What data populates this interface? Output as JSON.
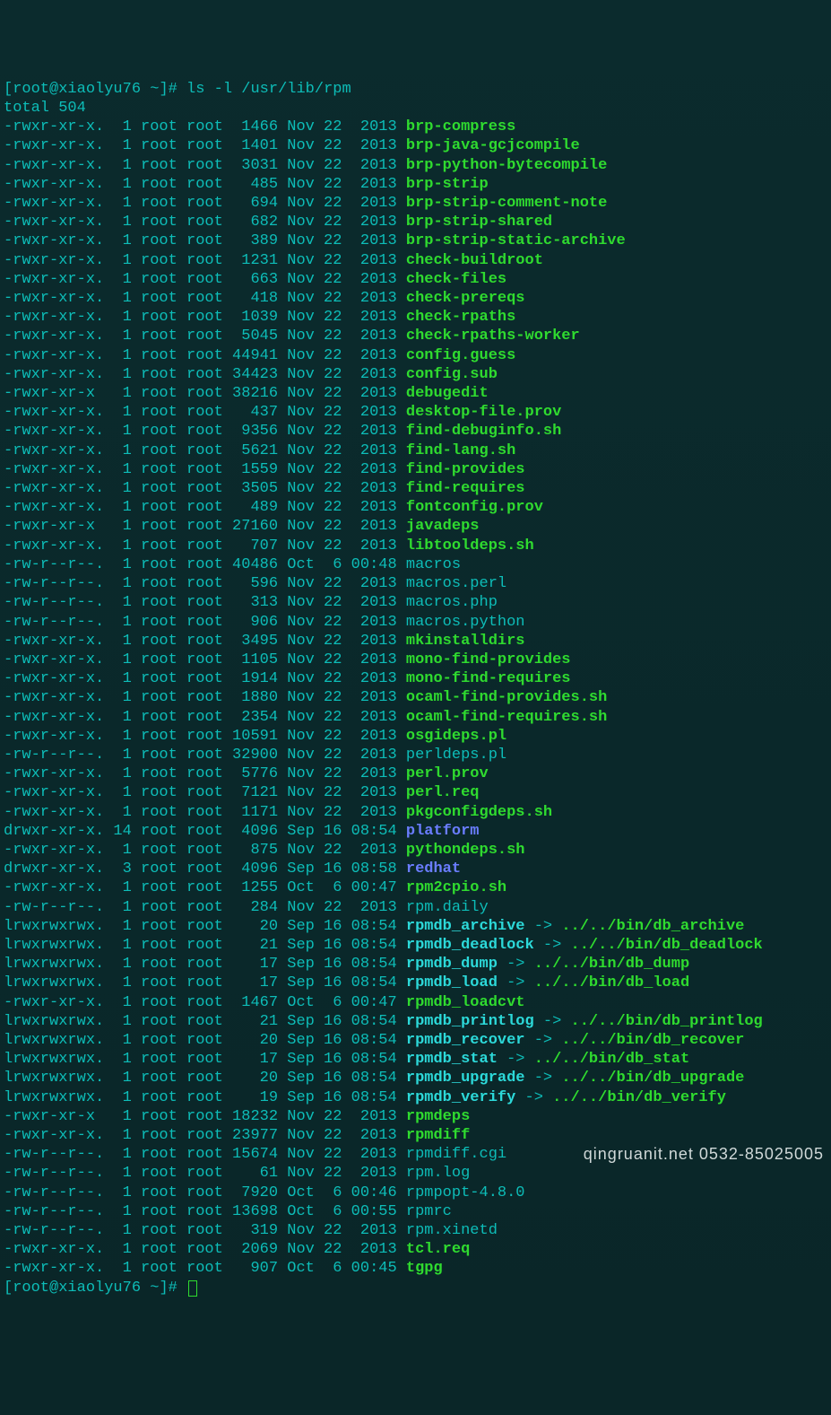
{
  "prompt": {
    "user_host": "root@xiaolyu76",
    "cwd": "~",
    "symbol": "#",
    "command": "ls -l /usr/lib/rpm"
  },
  "total_line": "total 504",
  "entries": [
    {
      "perm": "-rwxr-xr-x.",
      "links": "1",
      "owner": "root",
      "group": "root",
      "size": "1466",
      "month": "Nov",
      "day": "22",
      "time": "2013",
      "name": "brp-compress",
      "type": "exec"
    },
    {
      "perm": "-rwxr-xr-x.",
      "links": "1",
      "owner": "root",
      "group": "root",
      "size": "1401",
      "month": "Nov",
      "day": "22",
      "time": "2013",
      "name": "brp-java-gcjcompile",
      "type": "exec"
    },
    {
      "perm": "-rwxr-xr-x.",
      "links": "1",
      "owner": "root",
      "group": "root",
      "size": "3031",
      "month": "Nov",
      "day": "22",
      "time": "2013",
      "name": "brp-python-bytecompile",
      "type": "exec"
    },
    {
      "perm": "-rwxr-xr-x.",
      "links": "1",
      "owner": "root",
      "group": "root",
      "size": "485",
      "month": "Nov",
      "day": "22",
      "time": "2013",
      "name": "brp-strip",
      "type": "exec"
    },
    {
      "perm": "-rwxr-xr-x.",
      "links": "1",
      "owner": "root",
      "group": "root",
      "size": "694",
      "month": "Nov",
      "day": "22",
      "time": "2013",
      "name": "brp-strip-comment-note",
      "type": "exec"
    },
    {
      "perm": "-rwxr-xr-x.",
      "links": "1",
      "owner": "root",
      "group": "root",
      "size": "682",
      "month": "Nov",
      "day": "22",
      "time": "2013",
      "name": "brp-strip-shared",
      "type": "exec"
    },
    {
      "perm": "-rwxr-xr-x.",
      "links": "1",
      "owner": "root",
      "group": "root",
      "size": "389",
      "month": "Nov",
      "day": "22",
      "time": "2013",
      "name": "brp-strip-static-archive",
      "type": "exec"
    },
    {
      "perm": "-rwxr-xr-x.",
      "links": "1",
      "owner": "root",
      "group": "root",
      "size": "1231",
      "month": "Nov",
      "day": "22",
      "time": "2013",
      "name": "check-buildroot",
      "type": "exec"
    },
    {
      "perm": "-rwxr-xr-x.",
      "links": "1",
      "owner": "root",
      "group": "root",
      "size": "663",
      "month": "Nov",
      "day": "22",
      "time": "2013",
      "name": "check-files",
      "type": "exec"
    },
    {
      "perm": "-rwxr-xr-x.",
      "links": "1",
      "owner": "root",
      "group": "root",
      "size": "418",
      "month": "Nov",
      "day": "22",
      "time": "2013",
      "name": "check-prereqs",
      "type": "exec"
    },
    {
      "perm": "-rwxr-xr-x.",
      "links": "1",
      "owner": "root",
      "group": "root",
      "size": "1039",
      "month": "Nov",
      "day": "22",
      "time": "2013",
      "name": "check-rpaths",
      "type": "exec"
    },
    {
      "perm": "-rwxr-xr-x.",
      "links": "1",
      "owner": "root",
      "group": "root",
      "size": "5045",
      "month": "Nov",
      "day": "22",
      "time": "2013",
      "name": "check-rpaths-worker",
      "type": "exec"
    },
    {
      "perm": "-rwxr-xr-x.",
      "links": "1",
      "owner": "root",
      "group": "root",
      "size": "44941",
      "month": "Nov",
      "day": "22",
      "time": "2013",
      "name": "config.guess",
      "type": "exec"
    },
    {
      "perm": "-rwxr-xr-x.",
      "links": "1",
      "owner": "root",
      "group": "root",
      "size": "34423",
      "month": "Nov",
      "day": "22",
      "time": "2013",
      "name": "config.sub",
      "type": "exec"
    },
    {
      "perm": "-rwxr-xr-x",
      "links": "1",
      "owner": "root",
      "group": "root",
      "size": "38216",
      "month": "Nov",
      "day": "22",
      "time": "2013",
      "name": "debugedit",
      "type": "exec"
    },
    {
      "perm": "-rwxr-xr-x.",
      "links": "1",
      "owner": "root",
      "group": "root",
      "size": "437",
      "month": "Nov",
      "day": "22",
      "time": "2013",
      "name": "desktop-file.prov",
      "type": "exec"
    },
    {
      "perm": "-rwxr-xr-x.",
      "links": "1",
      "owner": "root",
      "group": "root",
      "size": "9356",
      "month": "Nov",
      "day": "22",
      "time": "2013",
      "name": "find-debuginfo.sh",
      "type": "exec"
    },
    {
      "perm": "-rwxr-xr-x.",
      "links": "1",
      "owner": "root",
      "group": "root",
      "size": "5621",
      "month": "Nov",
      "day": "22",
      "time": "2013",
      "name": "find-lang.sh",
      "type": "exec"
    },
    {
      "perm": "-rwxr-xr-x.",
      "links": "1",
      "owner": "root",
      "group": "root",
      "size": "1559",
      "month": "Nov",
      "day": "22",
      "time": "2013",
      "name": "find-provides",
      "type": "exec"
    },
    {
      "perm": "-rwxr-xr-x.",
      "links": "1",
      "owner": "root",
      "group": "root",
      "size": "3505",
      "month": "Nov",
      "day": "22",
      "time": "2013",
      "name": "find-requires",
      "type": "exec"
    },
    {
      "perm": "-rwxr-xr-x.",
      "links": "1",
      "owner": "root",
      "group": "root",
      "size": "489",
      "month": "Nov",
      "day": "22",
      "time": "2013",
      "name": "fontconfig.prov",
      "type": "exec"
    },
    {
      "perm": "-rwxr-xr-x",
      "links": "1",
      "owner": "root",
      "group": "root",
      "size": "27160",
      "month": "Nov",
      "day": "22",
      "time": "2013",
      "name": "javadeps",
      "type": "exec"
    },
    {
      "perm": "-rwxr-xr-x.",
      "links": "1",
      "owner": "root",
      "group": "root",
      "size": "707",
      "month": "Nov",
      "day": "22",
      "time": "2013",
      "name": "libtooldeps.sh",
      "type": "exec"
    },
    {
      "perm": "-rw-r--r--.",
      "links": "1",
      "owner": "root",
      "group": "root",
      "size": "40486",
      "month": "Oct",
      "day": "6",
      "time": "00:48",
      "name": "macros",
      "type": "txt"
    },
    {
      "perm": "-rw-r--r--.",
      "links": "1",
      "owner": "root",
      "group": "root",
      "size": "596",
      "month": "Nov",
      "day": "22",
      "time": "2013",
      "name": "macros.perl",
      "type": "txt"
    },
    {
      "perm": "-rw-r--r--.",
      "links": "1",
      "owner": "root",
      "group": "root",
      "size": "313",
      "month": "Nov",
      "day": "22",
      "time": "2013",
      "name": "macros.php",
      "type": "txt"
    },
    {
      "perm": "-rw-r--r--.",
      "links": "1",
      "owner": "root",
      "group": "root",
      "size": "906",
      "month": "Nov",
      "day": "22",
      "time": "2013",
      "name": "macros.python",
      "type": "txt"
    },
    {
      "perm": "-rwxr-xr-x.",
      "links": "1",
      "owner": "root",
      "group": "root",
      "size": "3495",
      "month": "Nov",
      "day": "22",
      "time": "2013",
      "name": "mkinstalldirs",
      "type": "exec"
    },
    {
      "perm": "-rwxr-xr-x.",
      "links": "1",
      "owner": "root",
      "group": "root",
      "size": "1105",
      "month": "Nov",
      "day": "22",
      "time": "2013",
      "name": "mono-find-provides",
      "type": "exec"
    },
    {
      "perm": "-rwxr-xr-x.",
      "links": "1",
      "owner": "root",
      "group": "root",
      "size": "1914",
      "month": "Nov",
      "day": "22",
      "time": "2013",
      "name": "mono-find-requires",
      "type": "exec"
    },
    {
      "perm": "-rwxr-xr-x.",
      "links": "1",
      "owner": "root",
      "group": "root",
      "size": "1880",
      "month": "Nov",
      "day": "22",
      "time": "2013",
      "name": "ocaml-find-provides.sh",
      "type": "exec"
    },
    {
      "perm": "-rwxr-xr-x.",
      "links": "1",
      "owner": "root",
      "group": "root",
      "size": "2354",
      "month": "Nov",
      "day": "22",
      "time": "2013",
      "name": "ocaml-find-requires.sh",
      "type": "exec"
    },
    {
      "perm": "-rwxr-xr-x.",
      "links": "1",
      "owner": "root",
      "group": "root",
      "size": "10591",
      "month": "Nov",
      "day": "22",
      "time": "2013",
      "name": "osgideps.pl",
      "type": "exec"
    },
    {
      "perm": "-rw-r--r--.",
      "links": "1",
      "owner": "root",
      "group": "root",
      "size": "32900",
      "month": "Nov",
      "day": "22",
      "time": "2013",
      "name": "perldeps.pl",
      "type": "txt"
    },
    {
      "perm": "-rwxr-xr-x.",
      "links": "1",
      "owner": "root",
      "group": "root",
      "size": "5776",
      "month": "Nov",
      "day": "22",
      "time": "2013",
      "name": "perl.prov",
      "type": "exec"
    },
    {
      "perm": "-rwxr-xr-x.",
      "links": "1",
      "owner": "root",
      "group": "root",
      "size": "7121",
      "month": "Nov",
      "day": "22",
      "time": "2013",
      "name": "perl.req",
      "type": "exec"
    },
    {
      "perm": "-rwxr-xr-x.",
      "links": "1",
      "owner": "root",
      "group": "root",
      "size": "1171",
      "month": "Nov",
      "day": "22",
      "time": "2013",
      "name": "pkgconfigdeps.sh",
      "type": "exec"
    },
    {
      "perm": "drwxr-xr-x.",
      "links": "14",
      "owner": "root",
      "group": "root",
      "size": "4096",
      "month": "Sep",
      "day": "16",
      "time": "08:54",
      "name": "platform",
      "type": "dir"
    },
    {
      "perm": "-rwxr-xr-x.",
      "links": "1",
      "owner": "root",
      "group": "root",
      "size": "875",
      "month": "Nov",
      "day": "22",
      "time": "2013",
      "name": "pythondeps.sh",
      "type": "exec"
    },
    {
      "perm": "drwxr-xr-x.",
      "links": "3",
      "owner": "root",
      "group": "root",
      "size": "4096",
      "month": "Sep",
      "day": "16",
      "time": "08:58",
      "name": "redhat",
      "type": "dir"
    },
    {
      "perm": "-rwxr-xr-x.",
      "links": "1",
      "owner": "root",
      "group": "root",
      "size": "1255",
      "month": "Oct",
      "day": "6",
      "time": "00:47",
      "name": "rpm2cpio.sh",
      "type": "exec"
    },
    {
      "perm": "-rw-r--r--.",
      "links": "1",
      "owner": "root",
      "group": "root",
      "size": "284",
      "month": "Nov",
      "day": "22",
      "time": "2013",
      "name": "rpm.daily",
      "type": "txt"
    },
    {
      "perm": "lrwxrwxrwx.",
      "links": "1",
      "owner": "root",
      "group": "root",
      "size": "20",
      "month": "Sep",
      "day": "16",
      "time": "08:54",
      "name": "rpmdb_archive",
      "type": "link",
      "target": "../../bin/db_archive"
    },
    {
      "perm": "lrwxrwxrwx.",
      "links": "1",
      "owner": "root",
      "group": "root",
      "size": "21",
      "month": "Sep",
      "day": "16",
      "time": "08:54",
      "name": "rpmdb_deadlock",
      "type": "link",
      "target": "../../bin/db_deadlock"
    },
    {
      "perm": "lrwxrwxrwx.",
      "links": "1",
      "owner": "root",
      "group": "root",
      "size": "17",
      "month": "Sep",
      "day": "16",
      "time": "08:54",
      "name": "rpmdb_dump",
      "type": "link",
      "target": "../../bin/db_dump"
    },
    {
      "perm": "lrwxrwxrwx.",
      "links": "1",
      "owner": "root",
      "group": "root",
      "size": "17",
      "month": "Sep",
      "day": "16",
      "time": "08:54",
      "name": "rpmdb_load",
      "type": "link",
      "target": "../../bin/db_load"
    },
    {
      "perm": "-rwxr-xr-x.",
      "links": "1",
      "owner": "root",
      "group": "root",
      "size": "1467",
      "month": "Oct",
      "day": "6",
      "time": "00:47",
      "name": "rpmdb_loadcvt",
      "type": "exec"
    },
    {
      "perm": "lrwxrwxrwx.",
      "links": "1",
      "owner": "root",
      "group": "root",
      "size": "21",
      "month": "Sep",
      "day": "16",
      "time": "08:54",
      "name": "rpmdb_printlog",
      "type": "link",
      "target": "../../bin/db_printlog"
    },
    {
      "perm": "lrwxrwxrwx.",
      "links": "1",
      "owner": "root",
      "group": "root",
      "size": "20",
      "month": "Sep",
      "day": "16",
      "time": "08:54",
      "name": "rpmdb_recover",
      "type": "link",
      "target": "../../bin/db_recover"
    },
    {
      "perm": "lrwxrwxrwx.",
      "links": "1",
      "owner": "root",
      "group": "root",
      "size": "17",
      "month": "Sep",
      "day": "16",
      "time": "08:54",
      "name": "rpmdb_stat",
      "type": "link",
      "target": "../../bin/db_stat"
    },
    {
      "perm": "lrwxrwxrwx.",
      "links": "1",
      "owner": "root",
      "group": "root",
      "size": "20",
      "month": "Sep",
      "day": "16",
      "time": "08:54",
      "name": "rpmdb_upgrade",
      "type": "link",
      "target": "../../bin/db_upgrade"
    },
    {
      "perm": "lrwxrwxrwx.",
      "links": "1",
      "owner": "root",
      "group": "root",
      "size": "19",
      "month": "Sep",
      "day": "16",
      "time": "08:54",
      "name": "rpmdb_verify",
      "type": "link",
      "target": "../../bin/db_verify"
    },
    {
      "perm": "-rwxr-xr-x",
      "links": "1",
      "owner": "root",
      "group": "root",
      "size": "18232",
      "month": "Nov",
      "day": "22",
      "time": "2013",
      "name": "rpmdeps",
      "type": "exec"
    },
    {
      "perm": "-rwxr-xr-x.",
      "links": "1",
      "owner": "root",
      "group": "root",
      "size": "23977",
      "month": "Nov",
      "day": "22",
      "time": "2013",
      "name": "rpmdiff",
      "type": "exec"
    },
    {
      "perm": "-rw-r--r--.",
      "links": "1",
      "owner": "root",
      "group": "root",
      "size": "15674",
      "month": "Nov",
      "day": "22",
      "time": "2013",
      "name": "rpmdiff.cgi",
      "type": "txt"
    },
    {
      "perm": "-rw-r--r--.",
      "links": "1",
      "owner": "root",
      "group": "root",
      "size": "61",
      "month": "Nov",
      "day": "22",
      "time": "2013",
      "name": "rpm.log",
      "type": "txt"
    },
    {
      "perm": "-rw-r--r--.",
      "links": "1",
      "owner": "root",
      "group": "root",
      "size": "7920",
      "month": "Oct",
      "day": "6",
      "time": "00:46",
      "name": "rpmpopt-4.8.0",
      "type": "txt"
    },
    {
      "perm": "-rw-r--r--.",
      "links": "1",
      "owner": "root",
      "group": "root",
      "size": "13698",
      "month": "Oct",
      "day": "6",
      "time": "00:55",
      "name": "rpmrc",
      "type": "txt"
    },
    {
      "perm": "-rw-r--r--.",
      "links": "1",
      "owner": "root",
      "group": "root",
      "size": "319",
      "month": "Nov",
      "day": "22",
      "time": "2013",
      "name": "rpm.xinetd",
      "type": "txt"
    },
    {
      "perm": "-rwxr-xr-x.",
      "links": "1",
      "owner": "root",
      "group": "root",
      "size": "2069",
      "month": "Nov",
      "day": "22",
      "time": "2013",
      "name": "tcl.req",
      "type": "exec"
    },
    {
      "perm": "-rwxr-xr-x.",
      "links": "1",
      "owner": "root",
      "group": "root",
      "size": "907",
      "month": "Oct",
      "day": "6",
      "time": "00:45",
      "name": "tgpg",
      "type": "exec"
    }
  ],
  "watermark": "qingruanit.net 0532-85025005"
}
